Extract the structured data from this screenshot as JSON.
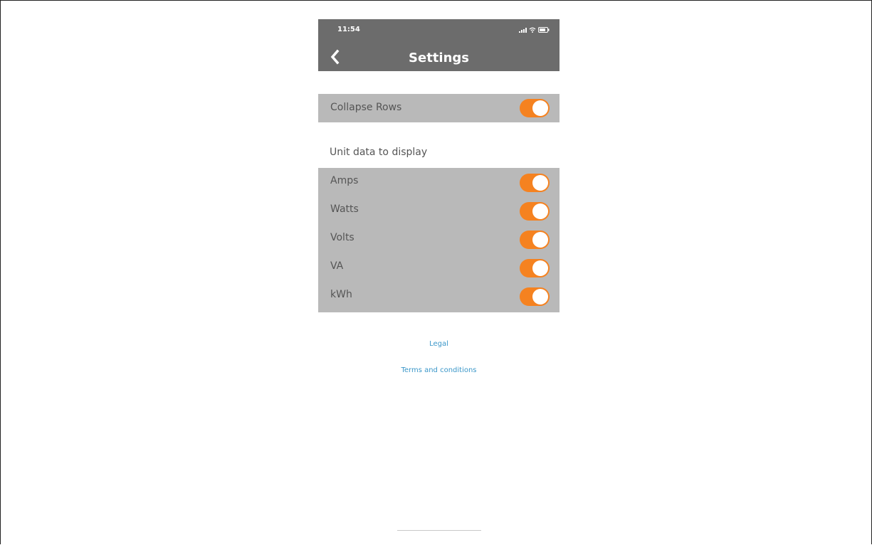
{
  "status_bar": {
    "time": "11:54",
    "icons": [
      "signal-icon",
      "wifi-icon",
      "battery-icon"
    ]
  },
  "header": {
    "title": "Settings",
    "back_icon": "chevron-left-icon"
  },
  "collapse_row": {
    "label": "Collapse Rows",
    "enabled": true
  },
  "unit_section": {
    "label": "Unit data to display",
    "items": [
      {
        "label": "Amps",
        "enabled": true
      },
      {
        "label": "Watts",
        "enabled": true
      },
      {
        "label": "Volts",
        "enabled": true
      },
      {
        "label": "VA",
        "enabled": true
      },
      {
        "label": "kWh",
        "enabled": true
      }
    ]
  },
  "links": {
    "legal": "Legal",
    "terms": "Terms and conditions"
  },
  "colors": {
    "header_bg": "#6c6c6c",
    "row_bg": "#b9b9b9",
    "toggle_on": "#f58220",
    "link": "#3b97c9"
  }
}
